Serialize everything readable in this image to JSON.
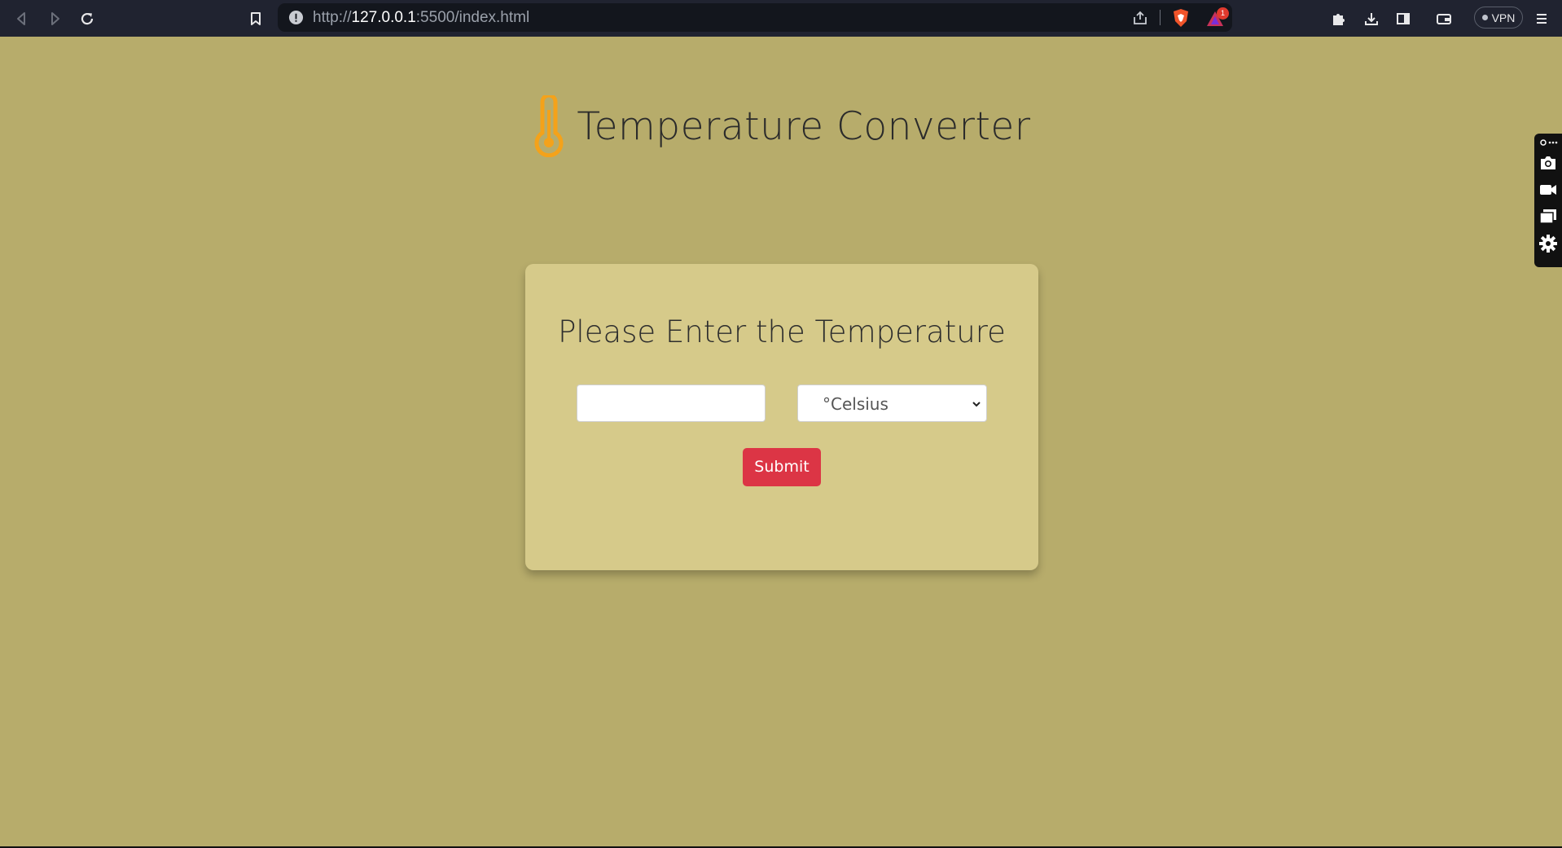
{
  "browser": {
    "url_scheme": "http://",
    "url_host": "127.0.0.1",
    "url_rest": ":5500/index.html",
    "vpn_label": "VPN",
    "alert_badge": "1"
  },
  "header": {
    "title": "Temperature Converter",
    "icon": "thermometer-icon"
  },
  "form": {
    "heading": "Please Enter the Temperature",
    "temperature_value": "",
    "unit_selected": "°Celsius",
    "submit_label": "Submit"
  },
  "colors": {
    "page_background": "#b7ac6b",
    "card_background": "#d6ca8a",
    "submit_button": "#dc3545",
    "thermometer": "#f4a21a"
  }
}
